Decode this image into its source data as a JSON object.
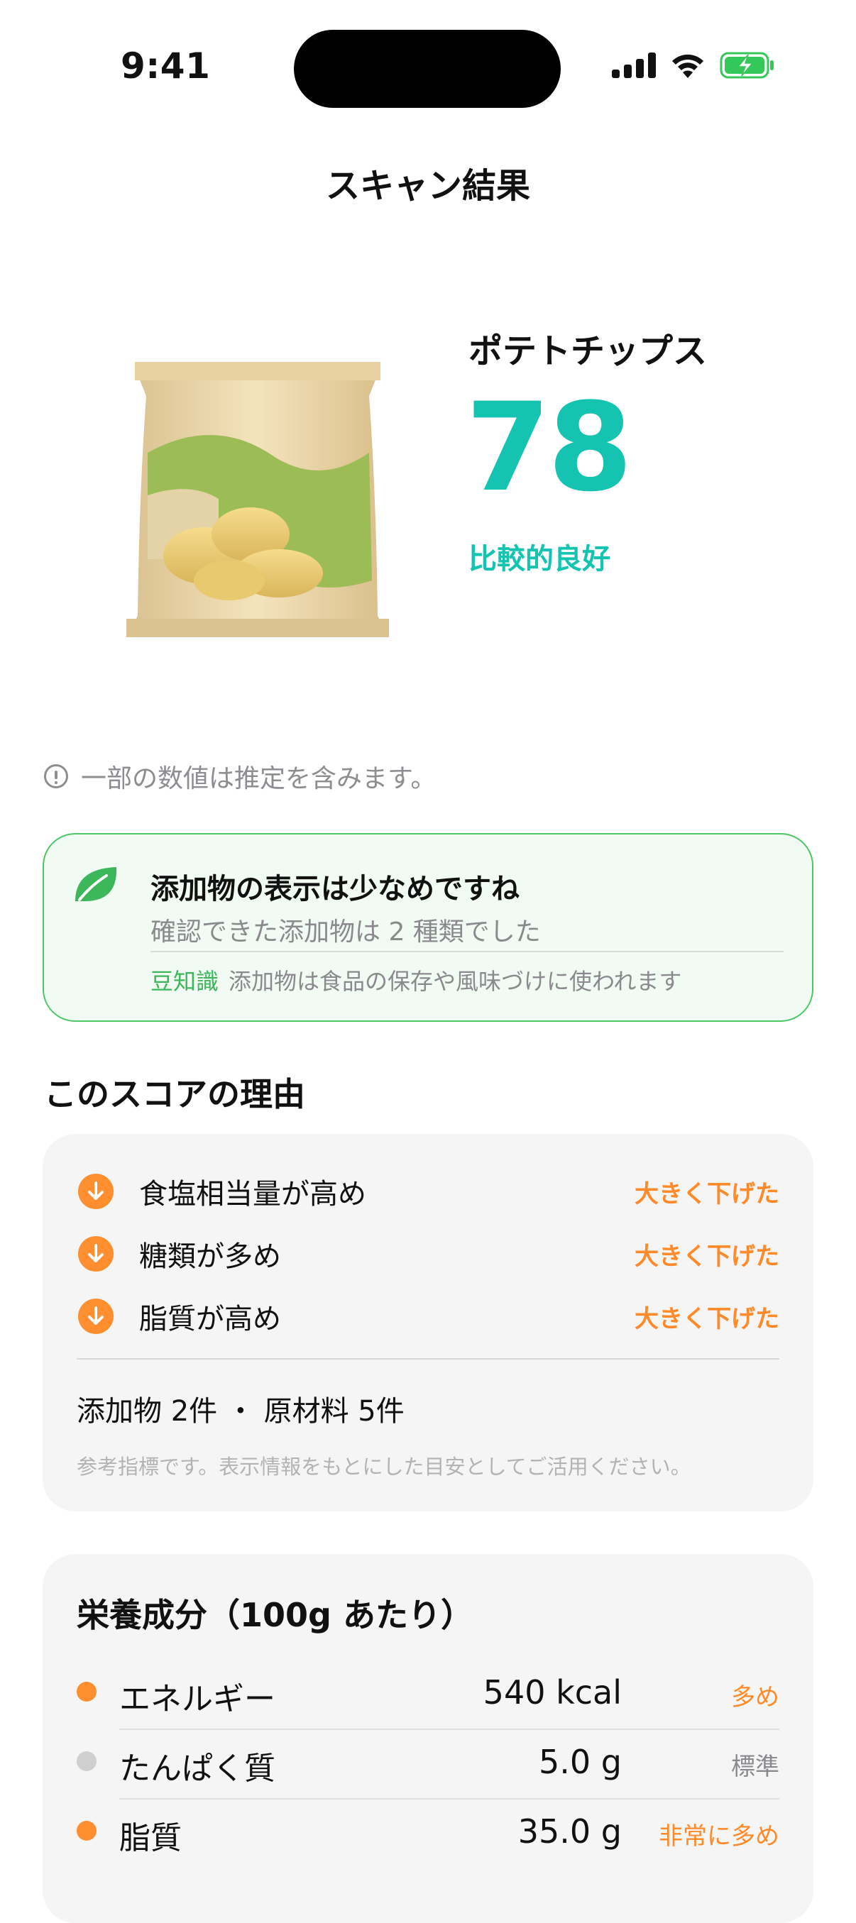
{
  "status_bar": {
    "time": "9:41",
    "icons": [
      "cellular-signal-icon",
      "wifi-icon",
      "battery-charging-icon"
    ],
    "battery_color": "#34c759"
  },
  "nav": {
    "title": "スキャン結果"
  },
  "product": {
    "name": "ポテトチップス",
    "score": "78",
    "grade": "比較的良好",
    "score_color": "#14c4b0"
  },
  "notice": {
    "icon": "info-icon",
    "text": "一部の数値は推定を含みます。"
  },
  "additive_card": {
    "icon": "leaf-icon",
    "title": "添加物の表示は少なめですね",
    "subtitle": "確認できた添加物は 2 種類でした",
    "tip_label": "豆知識",
    "tip_text": "添加物は食品の保存や風味づけに使われます",
    "accent": "#3cb75a"
  },
  "reasons": {
    "title": "このスコアの理由",
    "items": [
      {
        "icon": "arrow-down-icon",
        "label": "食塩相当量が高め",
        "effect": "大きく下げた"
      },
      {
        "icon": "arrow-down-icon",
        "label": "糖類が多め",
        "effect": "大きく下げた"
      },
      {
        "icon": "arrow-down-icon",
        "label": "脂質が高め",
        "effect": "大きく下げた"
      }
    ],
    "counts": "添加物 2件 ・ 原材料 5件",
    "reference": "参考指標です。表示情報をもとにした目安としてご活用ください。",
    "accent": "#ff8f2e"
  },
  "nutrition": {
    "title": "栄養成分（100g あたり）",
    "rows": [
      {
        "name": "エネルギー",
        "value": "540 kcal",
        "level": "多め",
        "dot_color": "#ff8f2e",
        "level_color": "#ff8a2a"
      },
      {
        "name": "たんぱく質",
        "value": "5.0 g",
        "level": "標準",
        "dot_color": "#cfcfcf",
        "level_color": "#8a8a8e"
      },
      {
        "name": "脂質",
        "value": "35.0 g",
        "level": "非常に多め",
        "dot_color": "#ff8f2e",
        "level_color": "#ff8a2a"
      }
    ]
  }
}
